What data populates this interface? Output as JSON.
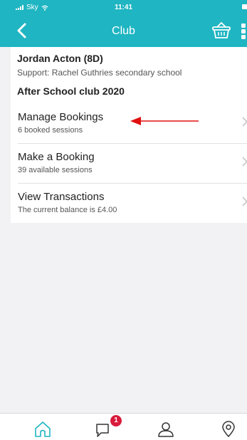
{
  "status_bar": {
    "carrier": "Sky",
    "time": "11:41"
  },
  "header": {
    "title": "Club",
    "back_icon": "chevron-left-icon",
    "basket_icon": "basket-icon"
  },
  "info": {
    "student_name": "Jordan Acton (8D)",
    "support_text": "Support: Rachel Guthries secondary school",
    "club_name": "After School club 2020"
  },
  "menu": [
    {
      "title": "Manage Bookings",
      "subtitle": "6 booked sessions"
    },
    {
      "title": "Make a Booking",
      "subtitle": "39 available sessions"
    },
    {
      "title": "View Transactions",
      "subtitle": "The current balance is £4.00"
    }
  ],
  "tabbar": {
    "items": [
      "home-icon",
      "messages-icon",
      "profile-icon",
      "location-icon"
    ],
    "messages_badge": "1"
  },
  "colors": {
    "header": "#1fb5c2",
    "accent": "#1fb5c2",
    "badge": "#d91b3c",
    "annotation_arrow": "#e01010"
  }
}
